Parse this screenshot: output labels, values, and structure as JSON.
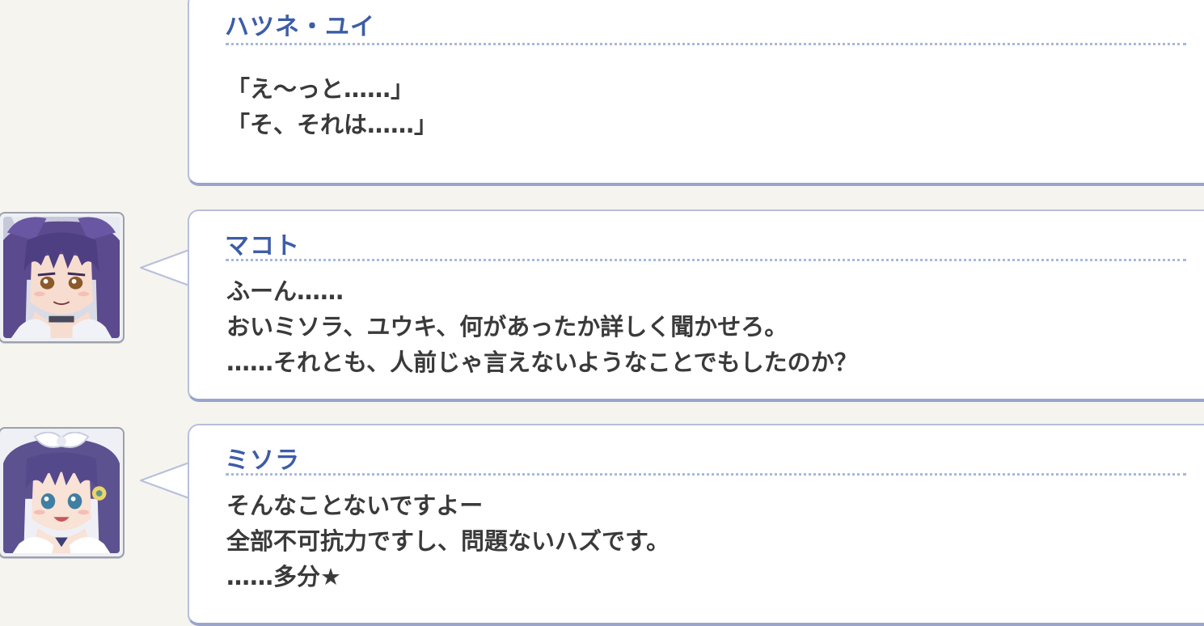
{
  "story_log": {
    "entries": [
      {
        "speaker": "ハツネ・ユイ",
        "has_portrait": false,
        "lines": [
          "「え～っと……」",
          "「そ、それは……」"
        ]
      },
      {
        "speaker": "マコト",
        "has_portrait": true,
        "portrait_icon": "makoto-portrait",
        "lines": [
          "ふーん……",
          "おいミソラ、ユウキ、何があったか詳しく聞かせろ。",
          "……それとも、人前じゃ言えないようなことでもしたのか？"
        ]
      },
      {
        "speaker": "ミソラ",
        "has_portrait": true,
        "portrait_icon": "misora-portrait",
        "lines": [
          "そんなことないですよー",
          "全部不可抗力ですし、問題ないハズです。",
          "……多分★"
        ]
      }
    ]
  },
  "colors": {
    "background": "#f5f4ef",
    "bubble": "#ffffff",
    "bubble_border": "#b7bfdc",
    "speaker_name": "#3d5da6",
    "dialogue_text": "#3a3a3a",
    "dotted_rule": "#a6b8de"
  }
}
